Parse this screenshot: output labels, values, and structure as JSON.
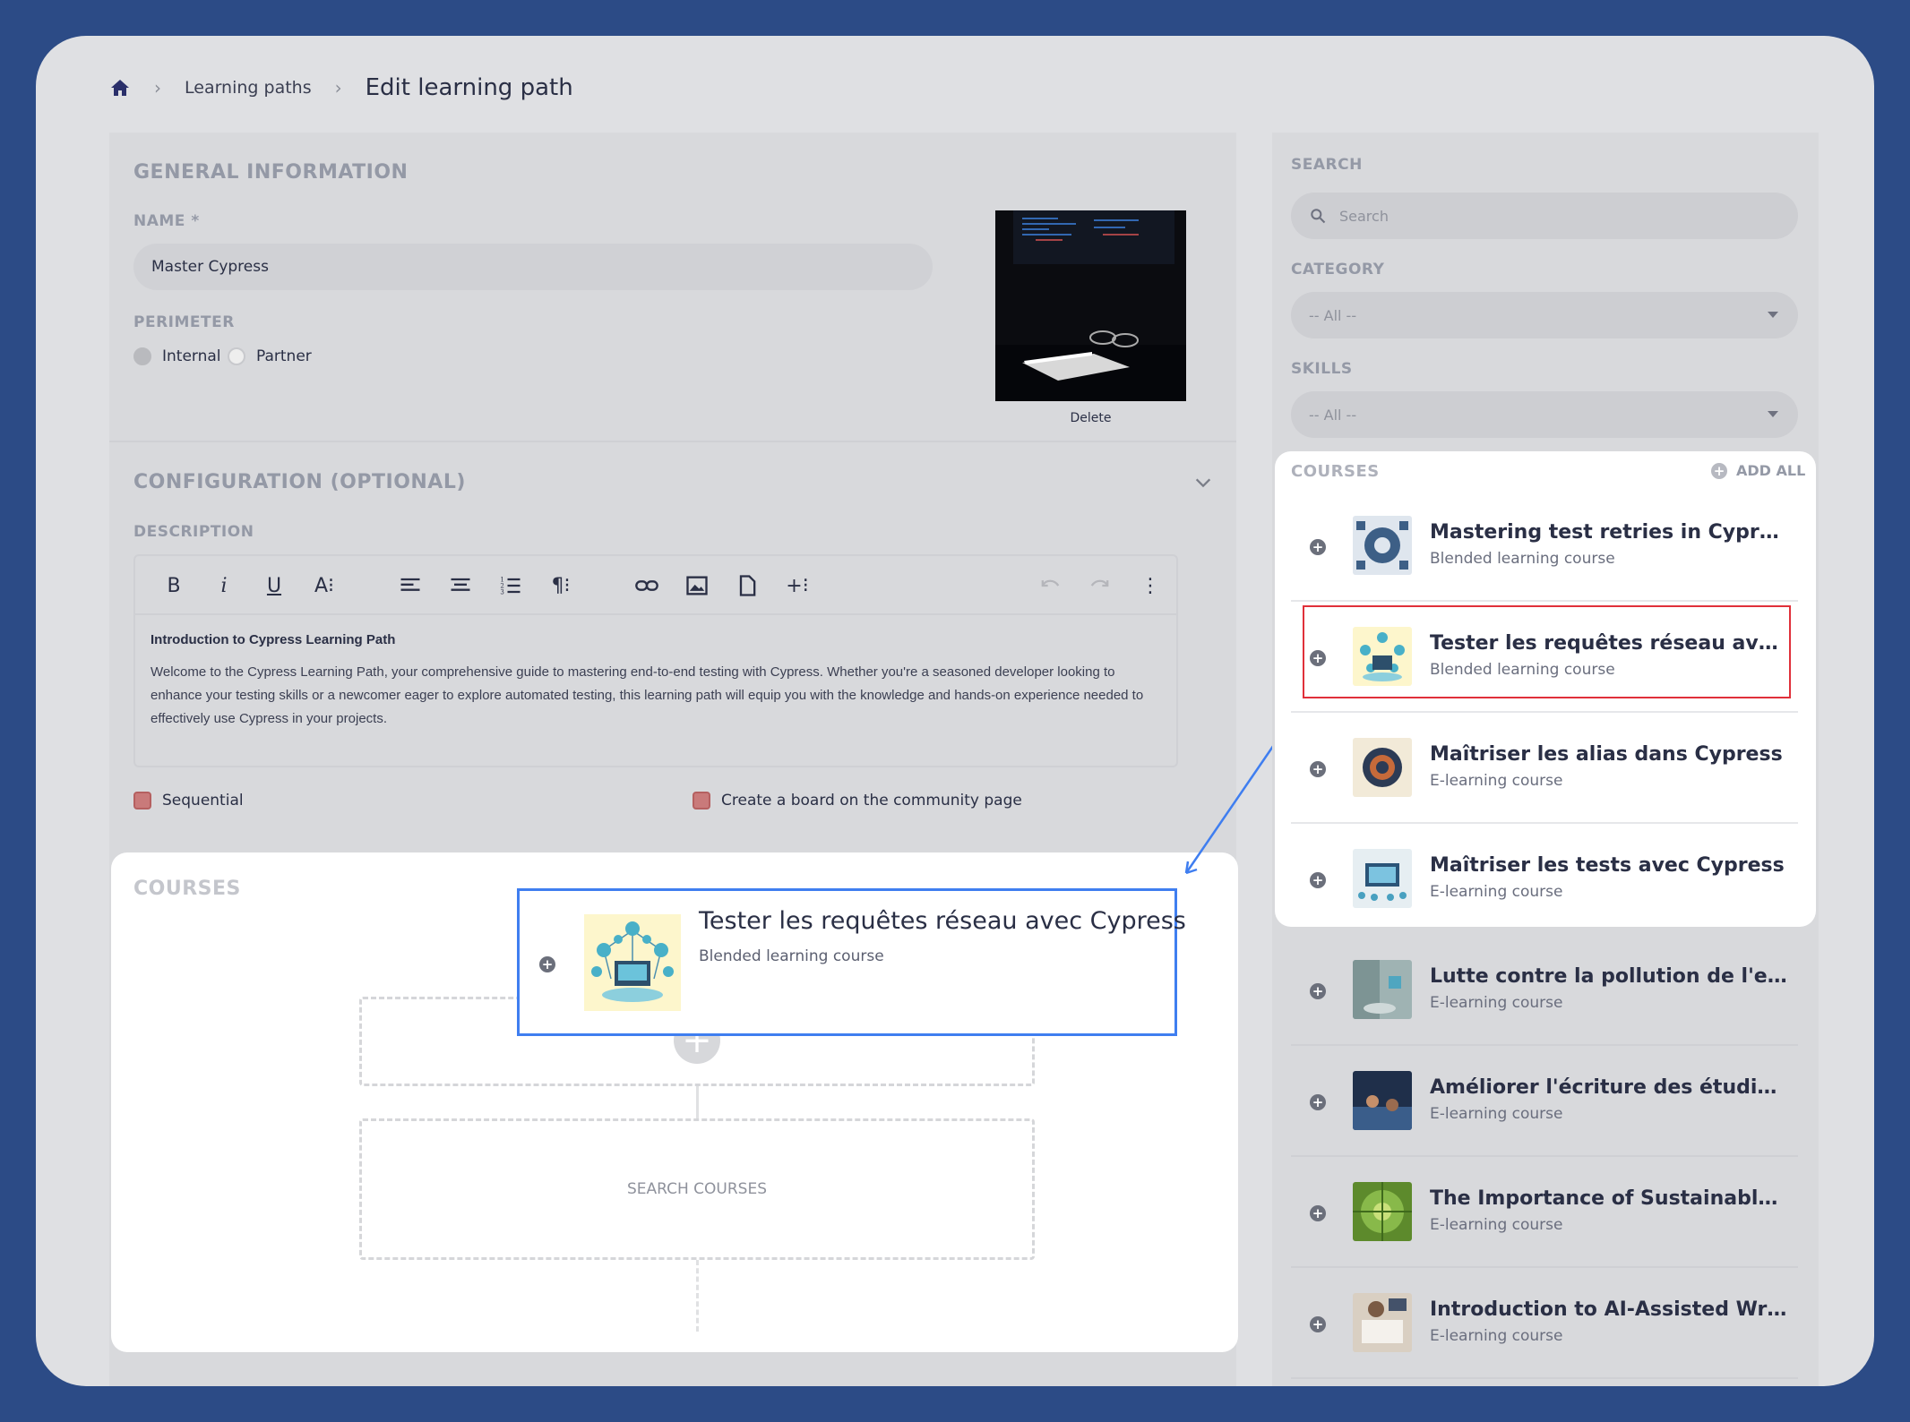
{
  "breadcrumb": {
    "home_icon": "home-icon",
    "items": [
      "Learning paths"
    ],
    "current": "Edit learning path"
  },
  "general": {
    "title": "GENERAL INFORMATION",
    "name_label": "NAME *",
    "name_value": "Master Cypress",
    "perimeter_label": "PERIMETER",
    "perimeter_options": [
      "Internal",
      "Partner"
    ],
    "perimeter_selected": "Internal",
    "image_delete": "Delete"
  },
  "configuration": {
    "title": "CONFIGURATION (OPTIONAL)",
    "description_label": "DESCRIPTION",
    "toolbar": [
      "B",
      "i",
      "U",
      "A⁝"
    ],
    "description_title": "Introduction to Cypress Learning Path",
    "description_body": "Welcome to the Cypress Learning Path, your comprehensive guide to mastering end-to-end testing with Cypress. Whether you're a seasoned developer looking to enhance your testing skills or a newcomer eager to explore automated testing, this learning path will equip you with the knowledge and hands-on experience needed to effectively use Cypress in your projects.",
    "sequential_label": "Sequential",
    "board_label": "Create a board on the community page"
  },
  "path_courses": {
    "title": "COURSES",
    "search_courses": "SEARCH COURSES",
    "dragging_card": {
      "title": "Tester les requêtes réseau avec Cypress",
      "subtitle": "Blended learning course"
    }
  },
  "sidebar": {
    "search_label": "SEARCH",
    "search_placeholder": "Search",
    "category_label": "CATEGORY",
    "category_value": "-- All --",
    "skills_label": "SKILLS",
    "skills_value": "-- All --",
    "courses_label": "COURSES",
    "add_all": "ADD ALL",
    "courses": [
      {
        "title": "Mastering test retries in Cypress",
        "subtitle": "Blended learning course"
      },
      {
        "title": "Tester les requêtes réseau avec C...",
        "subtitle": "Blended learning course"
      },
      {
        "title": "Maîtriser les alias dans Cypress",
        "subtitle": "E-learning course"
      },
      {
        "title": "Maîtriser les tests avec Cypress",
        "subtitle": "E-learning course"
      },
      {
        "title": "Lutte contre la pollution de l'eau:...",
        "subtitle": "E-learning course"
      },
      {
        "title": "Améliorer l'écriture des étudiant...",
        "subtitle": "E-learning course"
      },
      {
        "title": "The Importance of Sustainable W...",
        "subtitle": "E-learning course"
      },
      {
        "title": "Introduction to AI-Assisted Writing",
        "subtitle": "E-learning course"
      }
    ]
  },
  "colors": {
    "background": "#2c4b86",
    "highlight_red": "#e0303a",
    "drag_blue": "#3f7ef0",
    "checkbox": "#c97a7a"
  }
}
